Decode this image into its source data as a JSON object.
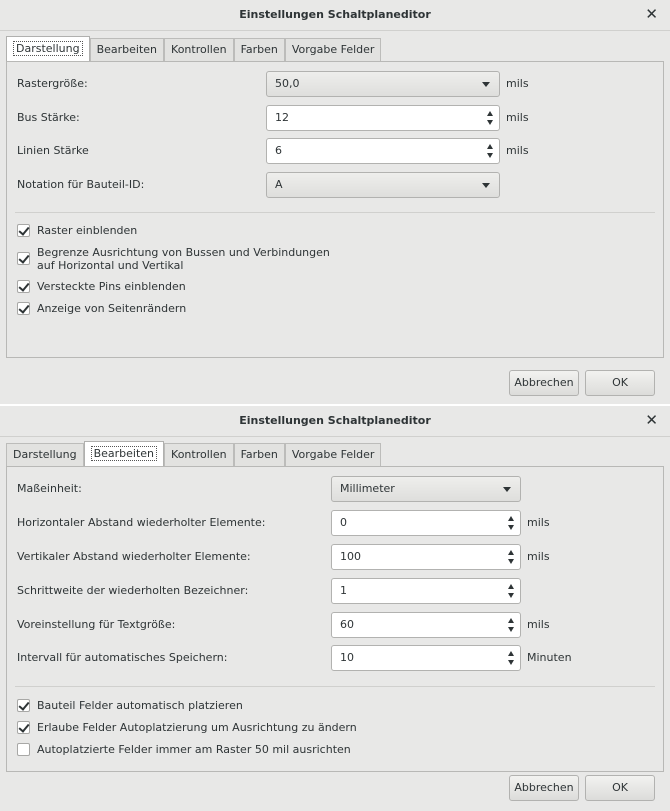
{
  "dialog1": {
    "title": "Einstellungen Schaltplaneditor",
    "tabs": [
      "Darstellung",
      "Bearbeiten",
      "Kontrollen",
      "Farben",
      "Vorgabe Felder"
    ],
    "active_tab": "Darstellung",
    "fields": {
      "grid_size": {
        "label": "Rastergröße:",
        "value": "50,0",
        "unit": "mils"
      },
      "bus_width": {
        "label": "Bus Stärke:",
        "value": "12",
        "unit": "mils"
      },
      "line_width": {
        "label": "Linien Stärke",
        "value": "6",
        "unit": "mils"
      },
      "ref_notation": {
        "label": "Notation für Bauteil-ID:",
        "value": "A"
      }
    },
    "checkboxes": [
      {
        "label": "Raster einblenden",
        "checked": true
      },
      {
        "label": "Begrenze Ausrichtung von Bussen und Verbindungen",
        "label2": "auf Horizontal und Vertikal",
        "checked": true
      },
      {
        "label": "Versteckte Pins einblenden",
        "checked": true
      },
      {
        "label": "Anzeige von Seitenrändern",
        "checked": true
      }
    ],
    "cancel_label": "Abbrechen",
    "ok_label": "OK"
  },
  "dialog2": {
    "title": "Einstellungen Schaltplaneditor",
    "tabs": [
      "Darstellung",
      "Bearbeiten",
      "Kontrollen",
      "Farben",
      "Vorgabe Felder"
    ],
    "active_tab": "Bearbeiten",
    "fields": {
      "unit": {
        "label": "Maßeinheit:",
        "value": "Millimeter"
      },
      "h_step": {
        "label": "Horizontaler Abstand wiederholter Elemente:",
        "value": "0",
        "unit": "mils"
      },
      "v_step": {
        "label": "Vertikaler Abstand wiederholter Elemente:",
        "value": "100",
        "unit": "mils"
      },
      "label_step": {
        "label": "Schrittweite der wiederholten Bezeichner:",
        "value": "1"
      },
      "text_size": {
        "label": "Voreinstellung für Textgröße:",
        "value": "60",
        "unit": "mils"
      },
      "autosave": {
        "label": "Intervall für automatisches Speichern:",
        "value": "10",
        "unit": "Minuten"
      }
    },
    "checkboxes": [
      {
        "label": "Bauteil Felder automatisch platzieren",
        "checked": true
      },
      {
        "label": "Erlaube Felder Autoplatzierung um Ausrichtung zu ändern",
        "checked": true
      },
      {
        "label": "Autoplatzierte Felder immer am Raster 50 mil ausrichten",
        "checked": false
      }
    ],
    "cancel_label": "Abbrechen",
    "ok_label": "OK"
  },
  "icons": {
    "close": "close-icon",
    "dropdown": "chevron-down-icon",
    "spin_up": "spin-up-icon",
    "spin_down": "spin-down-icon",
    "check": "checkmark-icon"
  }
}
